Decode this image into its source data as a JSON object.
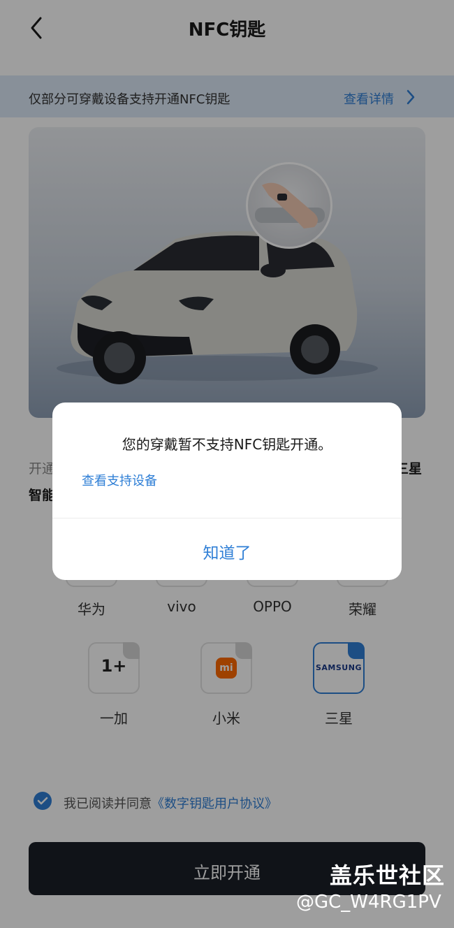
{
  "header": {
    "title": "NFC钥匙"
  },
  "notice": {
    "text": "仅部分可穿戴设备支持开通NFC钥匙",
    "link": "查看详情"
  },
  "content": {
    "desc_line1_start": "开通",
    "desc_line1_end": "三星",
    "desc_line2_start": "智能"
  },
  "brands": [
    {
      "label": "华为"
    },
    {
      "label": "vivo"
    },
    {
      "label": "OPPO"
    },
    {
      "label": "荣耀"
    },
    {
      "label": "一加",
      "logo": "1+"
    },
    {
      "label": "小米",
      "logo": "mi"
    },
    {
      "label": "三星",
      "logo": "SAMSUNG"
    }
  ],
  "agreement": {
    "prefix": "我已阅读并同意",
    "link": "《数字钥匙用户协议》"
  },
  "cta": {
    "label": "立即开通"
  },
  "watermark": {
    "line1": "盖乐世社区",
    "line2": "@GC_W4RG1PV"
  },
  "dialog": {
    "message": "您的穿戴暂不支持NFC钥匙开通。",
    "link": "查看支持设备",
    "ok": "知道了"
  },
  "colors": {
    "accent": "#2f7fd6",
    "cta_bg": "#1b1f27",
    "notice_bg": "#dbe8f7"
  }
}
